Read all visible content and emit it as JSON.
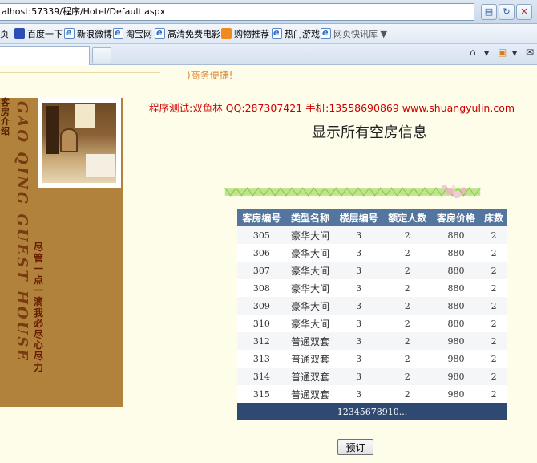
{
  "browser": {
    "address": "alhost:57339/程序/Hotel/Default.aspx",
    "favorites": [
      {
        "label": "页",
        "icon": "ie-page-icon"
      },
      {
        "label": "百度一下",
        "icon": "baidu-paw-icon"
      },
      {
        "label": "新浪微博",
        "icon": "ie-page-icon"
      },
      {
        "label": "淘宝网",
        "icon": "ie-page-icon"
      },
      {
        "label": "高清免费电影",
        "icon": "ie-page-icon"
      },
      {
        "label": "购物推荐",
        "icon": "shopping-icon"
      },
      {
        "label": "热门游戏",
        "icon": "ie-page-icon"
      },
      {
        "label": "网页快讯库",
        "icon": "ie-page-icon"
      }
    ]
  },
  "page": {
    "slogan": ")商务便捷!",
    "sidebar_title": "客房介绍",
    "brand_vertical": "GAO QING GUEST HOUSE",
    "motto": "尽管一点一滴 我必尽心尽力",
    "contact": "程序测试:双鱼林 QQ:287307421 手机:13558690869 www.shuangyulin.com",
    "title": "显示所有空房信息",
    "book_button": "预订"
  },
  "table": {
    "headers": [
      "客房编号",
      "类型名称",
      "楼层编号",
      "额定人数",
      "客房价格",
      "床数"
    ],
    "rows": [
      [
        "305",
        "豪华大间",
        "3",
        "2",
        "880",
        "2"
      ],
      [
        "306",
        "豪华大间",
        "3",
        "2",
        "880",
        "2"
      ],
      [
        "307",
        "豪华大间",
        "3",
        "2",
        "880",
        "2"
      ],
      [
        "308",
        "豪华大间",
        "3",
        "2",
        "880",
        "2"
      ],
      [
        "309",
        "豪华大间",
        "3",
        "2",
        "880",
        "2"
      ],
      [
        "310",
        "豪华大间",
        "3",
        "2",
        "880",
        "2"
      ],
      [
        "312",
        "普通双套",
        "3",
        "2",
        "980",
        "2"
      ],
      [
        "313",
        "普通双套",
        "3",
        "2",
        "980",
        "2"
      ],
      [
        "314",
        "普通双套",
        "3",
        "2",
        "980",
        "2"
      ],
      [
        "315",
        "普通双套",
        "3",
        "2",
        "980",
        "2"
      ]
    ],
    "pager": [
      "1",
      "2",
      "3",
      "4",
      "5",
      "6",
      "7",
      "8",
      "9",
      "10",
      "..."
    ]
  },
  "colors": {
    "header_bg": "#54759d",
    "pager_bg": "#2e4a73",
    "contact_text": "#cc0000",
    "sidebar_bg": "#b0823c"
  }
}
